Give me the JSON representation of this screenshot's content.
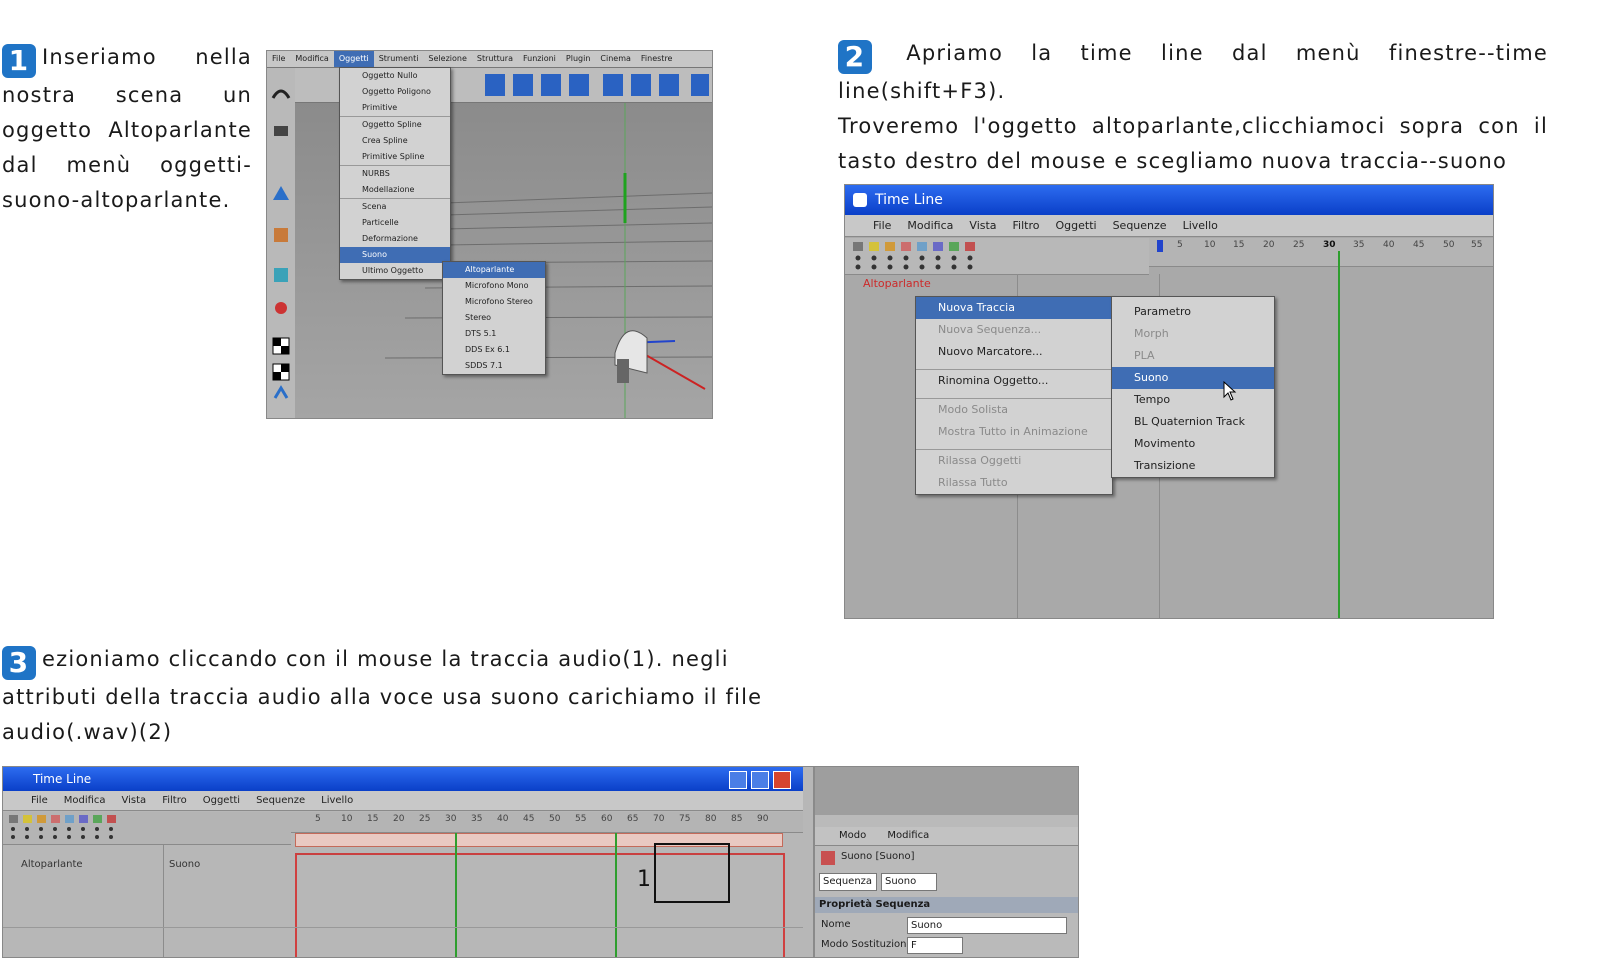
{
  "step1": {
    "number": "1",
    "text": "Inseriamo nella nostra scena un oggetto Altoparlante dal menù oggetti-suono-altoparlante."
  },
  "step2": {
    "number": "2",
    "text_line1": "Apriamo la time line dal menù finestre--time line(shift+F3).",
    "text_line2": "Troveremo l'oggetto altoparlante,clicchiamoci sopra con il tasto destro del mouse e scegliamo nuova traccia--suono"
  },
  "step3": {
    "number": "3",
    "text": "ezioniamo cliccando con il mouse la traccia audio(1). negli attributi della traccia audio alla voce usa suono carichiamo il file audio(.wav)(2)"
  },
  "screenshot1": {
    "menubar": [
      "File",
      "Modifica",
      "Oggetti",
      "Strumenti",
      "Selezione",
      "Struttura",
      "Funzioni",
      "Plugin",
      "Cinema",
      "Finestre"
    ],
    "menu_items": [
      "Oggetto Nullo",
      "Oggetto Poligono",
      "Primitive",
      "Oggetto Spline",
      "Crea Spline",
      "Primitive Spline",
      "NURBS",
      "Modellazione",
      "Scena",
      "Particelle",
      "Deformazione",
      "Suono",
      "Ultimo Oggetto"
    ],
    "submenu_items": [
      "Altoparlante",
      "Microfono Mono",
      "Microfono Stereo",
      "Stereo",
      "DTS 5.1",
      "DDS Ex 6.1",
      "SDDS 7.1"
    ]
  },
  "screenshot2": {
    "title": "Time Line",
    "menubar": [
      "File",
      "Modifica",
      "Vista",
      "Filtro",
      "Oggetti",
      "Sequenze",
      "Livello"
    ],
    "ruler_ticks": [
      "5",
      "10",
      "15",
      "20",
      "25",
      "30",
      "35",
      "40",
      "45",
      "50",
      "55"
    ],
    "object_label": "Altoparlante",
    "context_menu": [
      "Nuova Traccia",
      "Nuova Sequenza...",
      "Nuovo Marcatore...",
      "Rinomina Oggetto...",
      "Modo Solista",
      "Mostra Tutto in Animazione",
      "Rilassa Oggetti",
      "Rilassa Tutto"
    ],
    "submenu": [
      "Parametro",
      "Morph",
      "PLA",
      "Suono",
      "Tempo",
      "BL Quaternion Track",
      "Movimento",
      "Transizione"
    ]
  },
  "screenshot3": {
    "title": "Time Line",
    "menubar": [
      "File",
      "Modifica",
      "Vista",
      "Filtro",
      "Oggetti",
      "Sequenze",
      "Livello"
    ],
    "ruler_ticks": [
      "5",
      "10",
      "15",
      "20",
      "25",
      "30",
      "35",
      "40",
      "45",
      "50",
      "55",
      "60",
      "65",
      "70",
      "75",
      "80",
      "85",
      "90"
    ],
    "object_label": "Altoparlante",
    "track_label": "Suono",
    "callout_number": "1",
    "attr_menubar": [
      "Modo",
      "Modifica"
    ],
    "attr_title": "Suono [Suono]",
    "attr_tabs": [
      "Sequenza",
      "Suono"
    ],
    "section_header": "Proprietà Sequenza",
    "field_name_label": "Nome",
    "field_name_value": "Suono",
    "field_mode_label": "Modo Sostituzione",
    "field_mode_value": "F"
  }
}
